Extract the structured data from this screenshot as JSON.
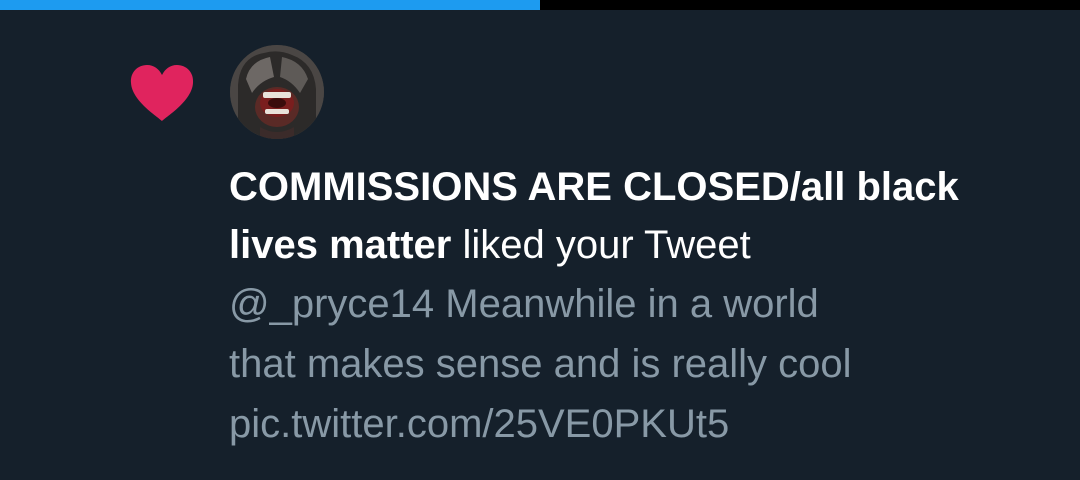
{
  "progress": {
    "fraction": 0.5,
    "fill_color": "#1d9bf0",
    "track_color": "#000000"
  },
  "notification": {
    "type_icon": "heart-icon",
    "icon_color": "#e0245e",
    "avatar_icon": "avatar-icon",
    "actor_name": "COMMISSIONS ARE CLOSED/all black lives matter",
    "action_text": " liked your Tweet",
    "tweet_text": "@_pryce14 Meanwhile in a world\nthat makes sense and is really cool\npic.twitter.com/25VE0PKUt5"
  },
  "colors": {
    "background": "#15202b",
    "primary_text": "#ffffff",
    "secondary_text": "#8899a6"
  }
}
